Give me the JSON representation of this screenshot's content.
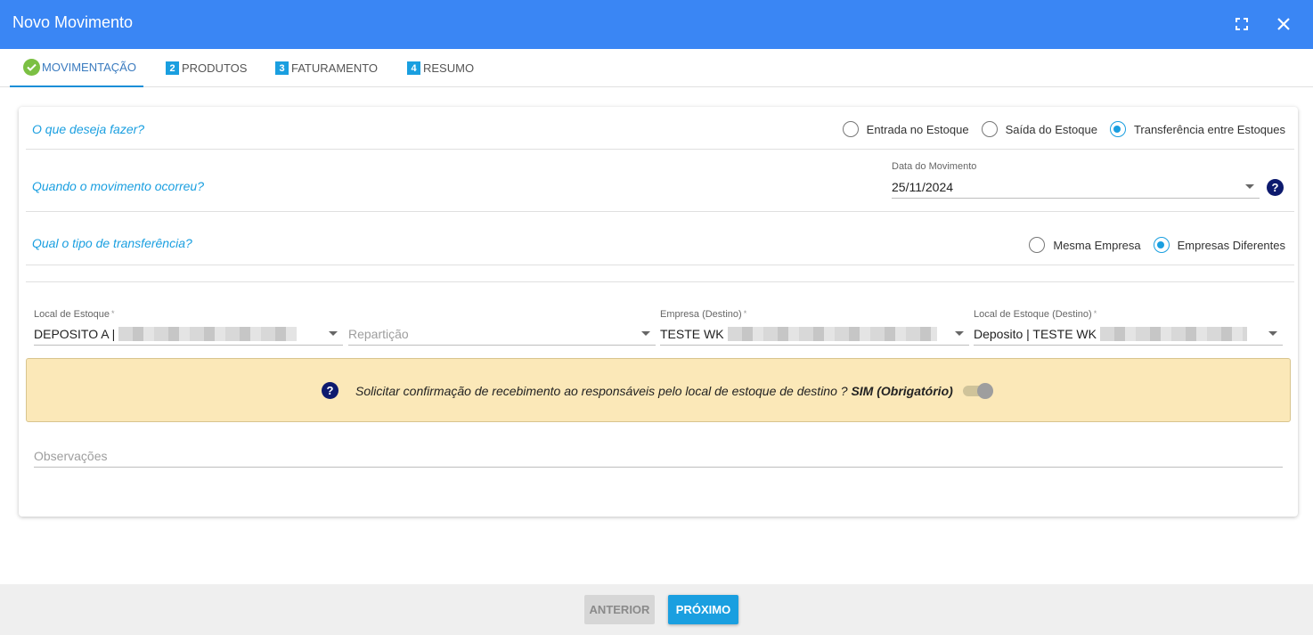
{
  "window": {
    "title": "Novo Movimento",
    "icons": {
      "maximize": "fullscreen-icon",
      "close": "close-icon"
    }
  },
  "tabs": [
    {
      "label": "MOVIMENTAÇÃO",
      "badge": "",
      "icon": "check-circle-icon",
      "active": true
    },
    {
      "label": "PRODUTOS",
      "badge": "2",
      "active": false
    },
    {
      "label": "FATURAMENTO",
      "badge": "3",
      "active": false
    },
    {
      "label": "RESUMO",
      "badge": "4",
      "active": false
    }
  ],
  "section_what": {
    "question": "O que deseja fazer?",
    "options": [
      "Entrada no Estoque",
      "Saída do Estoque",
      "Transferência entre Estoques"
    ],
    "selected": "Transferência entre Estoques"
  },
  "section_when": {
    "question": "Quando o movimento ocorreu?",
    "date_label": "Data do Movimento",
    "date_value": "25/11/2024"
  },
  "section_type": {
    "question": "Qual o tipo de transferência?",
    "options": [
      "Mesma Empresa",
      "Empresas Diferentes"
    ],
    "selected": "Empresas Diferentes"
  },
  "fields": {
    "local_estoque": {
      "label": "Local de Estoque",
      "value": "DEPOSITO A |"
    },
    "reparticao": {
      "placeholder": "Repartição"
    },
    "empresa_destino": {
      "label": "Empresa (Destino)",
      "value": "TESTE WK"
    },
    "local_estoque_destino": {
      "label": "Local de Estoque (Destino)",
      "value": "Deposito | TESTE WK"
    },
    "required_mark": "*"
  },
  "notice": {
    "text": "Solicitar confirmação de recebimento ao responsáveis pelo local de estoque de destino ?",
    "emphasis": "SIM (Obrigatório)",
    "help_glyph": "?"
  },
  "observacoes": {
    "placeholder": "Observações"
  },
  "footer": {
    "prev_label": "ANTERIOR",
    "next_label": "PRÓXIMO"
  },
  "colors": {
    "header": "#3a86f4",
    "accent": "#1a9fe0",
    "notice_bg": "#fbe8b8",
    "success": "#7bc043"
  }
}
